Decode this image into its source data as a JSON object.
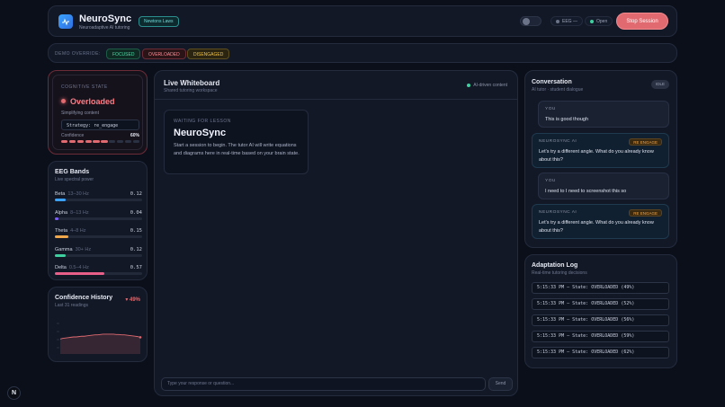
{
  "header": {
    "brand": "NeuroSync",
    "tagline": "Neuroadaptive AI tutoring",
    "topic": "Newtons Laws",
    "eeg_label": "EEG —",
    "open_label": "Open",
    "stop_label": "Stop Session"
  },
  "demo": {
    "label": "DEMO OVERRIDE:",
    "buttons": [
      "FOCUSED",
      "OVERLOADED",
      "DISENGAGED"
    ]
  },
  "cognitive": {
    "label": "COGNITIVE STATE",
    "state": "Overloaded",
    "sub": "Simplifying content",
    "strategy": "Strategy: re_engage",
    "confidence_label": "Confidence",
    "confidence_value": "60%",
    "confidence_fraction": 0.6
  },
  "eeg": {
    "title": "EEG Bands",
    "subtitle": "Live spectral power",
    "bands": [
      {
        "name": "Beta",
        "range": "13–30 Hz",
        "value": "0.12",
        "fraction": 0.12,
        "color": "#3ba3ff"
      },
      {
        "name": "Alpha",
        "range": "8–13 Hz",
        "value": "0.04",
        "fraction": 0.04,
        "color": "#7b5cff"
      },
      {
        "name": "Theta",
        "range": "4–8 Hz",
        "value": "0.15",
        "fraction": 0.15,
        "color": "#f0a64a"
      },
      {
        "name": "Gamma",
        "range": "30+ Hz",
        "value": "0.12",
        "fraction": 0.12,
        "color": "#3fd0a0"
      },
      {
        "name": "Delta",
        "range": "0.5–4 Hz",
        "value": "0.57",
        "fraction": 0.57,
        "color": "#e8608a"
      }
    ]
  },
  "confidence_history": {
    "title": "Confidence History",
    "subtitle": "Last 31 readings",
    "delta": "▾ 49%",
    "readings": [
      0.44,
      0.46,
      0.47,
      0.48,
      0.49,
      0.5,
      0.5,
      0.51,
      0.52,
      0.52,
      0.53,
      0.54,
      0.55,
      0.56,
      0.56,
      0.57,
      0.58,
      0.58,
      0.58,
      0.58,
      0.58,
      0.57,
      0.57,
      0.56,
      0.56,
      0.55,
      0.54,
      0.53,
      0.52,
      0.51,
      0.49
    ]
  },
  "whiteboard": {
    "title": "Live Whiteboard",
    "subtitle": "Shared tutoring workspace",
    "status": "AI-driven content",
    "card_label": "WAITING FOR LESSON",
    "card_title": "NeuroSync",
    "card_text": "Start a session to begin. The tutor AI will write equations and diagrams here in real-time based on your brain state.",
    "input_placeholder": "Type your response or question...",
    "send_label": "Send"
  },
  "conversation": {
    "title": "Conversation",
    "subtitle": "AI tutor · student dialogue",
    "status": "IDLE",
    "messages": [
      {
        "role": "user",
        "who": "YOU",
        "text": "This is good though"
      },
      {
        "role": "ai",
        "who": "NEUROSYNC AI",
        "tag": "RE ENGAGE",
        "text": "Let's try a different angle. What do you already know about this?"
      },
      {
        "role": "user",
        "who": "YOU",
        "text": "I need to I need to screenshot this so"
      },
      {
        "role": "ai",
        "who": "NEUROSYNC AI",
        "tag": "RE ENGAGE",
        "text": "Let's try a different angle. What do you already know about this?"
      }
    ]
  },
  "log": {
    "title": "Adaptation Log",
    "subtitle": "Real-time tutoring decisions",
    "entries": [
      "5:15:33 PM — State: OVERLOADED (49%)",
      "5:15:33 PM — State: OVERLOADED (52%)",
      "5:15:33 PM — State: OVERLOADED (56%)",
      "5:15:33 PM — State: OVERLOADED (59%)",
      "5:15:33 PM — State: OVERLOADED (62%)"
    ]
  },
  "corner_badge": "N",
  "colors": {
    "overloaded": "#e06a70",
    "focused": "#3fd0a0",
    "disengaged": "#f0c24a",
    "accent": "#3ba3ff"
  }
}
